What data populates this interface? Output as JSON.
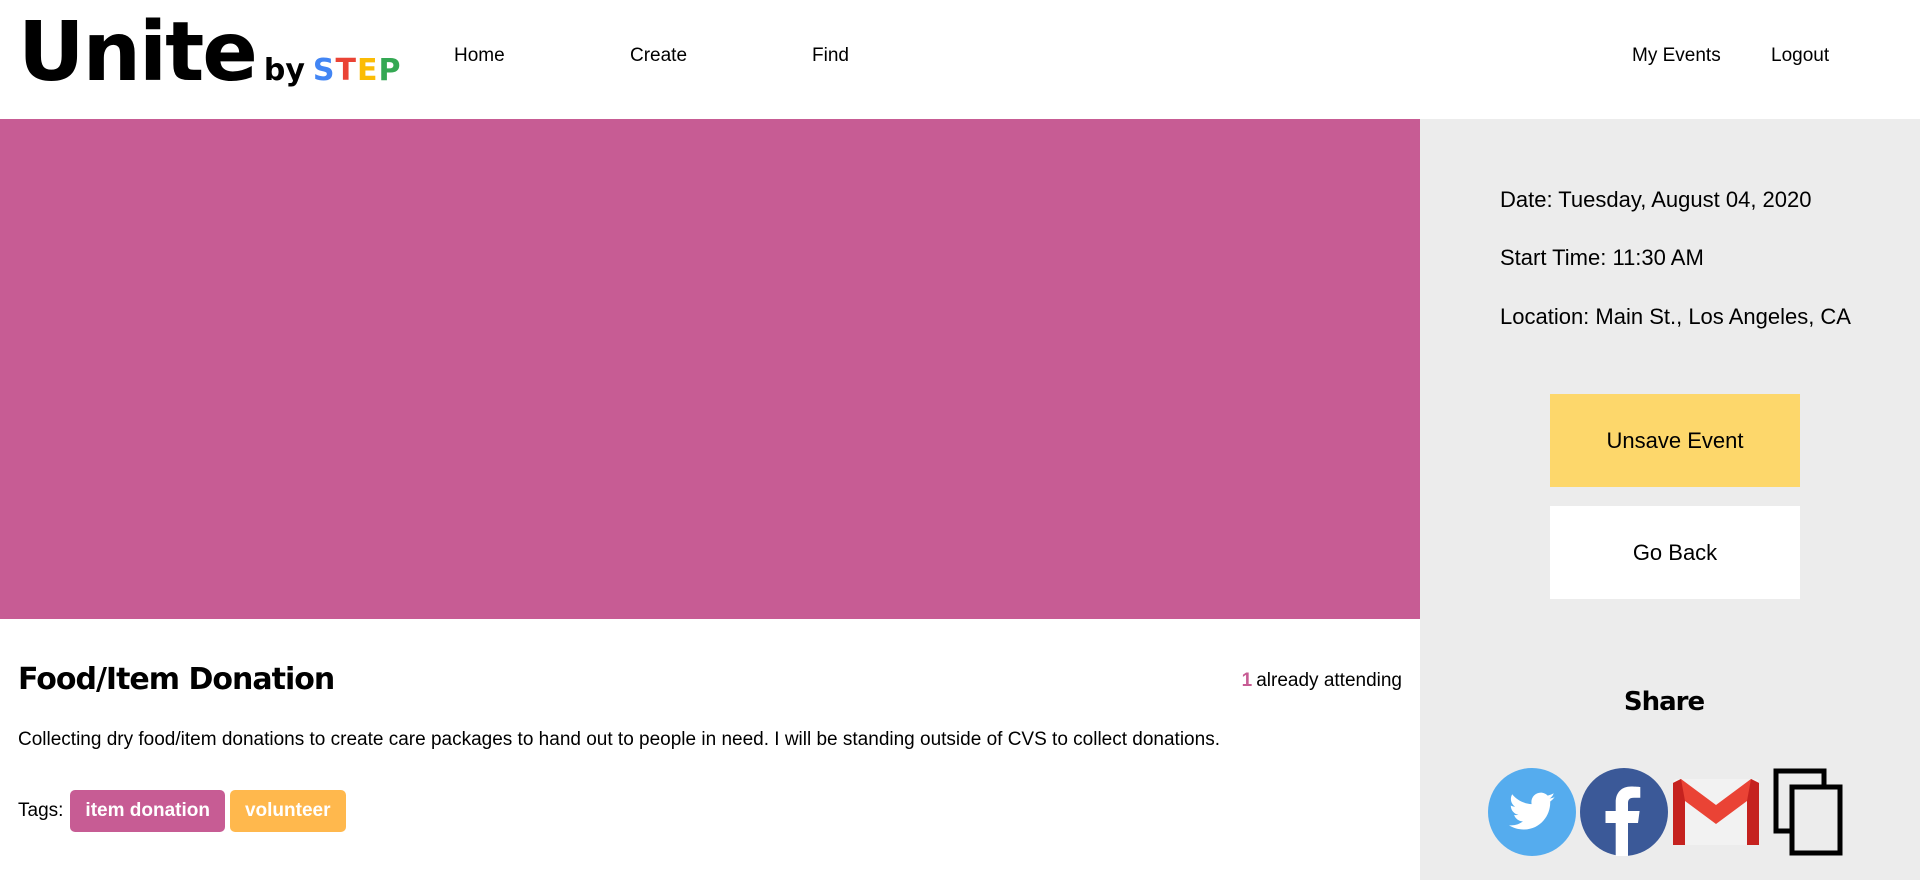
{
  "brand": {
    "name": "Unite",
    "by": "by",
    "step_letters": [
      "S",
      "T",
      "E",
      "P"
    ],
    "step_colors": [
      "#4285f4",
      "#ea4335",
      "#fbbc05",
      "#34a853"
    ]
  },
  "nav": {
    "home": "Home",
    "create": "Create",
    "find": "Find",
    "my_events": "My Events",
    "logout": "Logout"
  },
  "hero": {
    "color": "#c75c94"
  },
  "event": {
    "title": "Food/Item Donation",
    "attending_count": "1",
    "attending_text": "already attending",
    "description": "Collecting dry food/item donations to create care packages to hand out to people in need. I will be standing outside of CVS to collect donations.",
    "tags_label": "Tags:",
    "tags": [
      {
        "label": "item donation",
        "color": "#c75c94"
      },
      {
        "label": "volunteer",
        "color": "#ffb84d"
      }
    ]
  },
  "sidebar": {
    "date": "Date: Tuesday, August 04, 2020",
    "start_time": "Start Time: 11:30 AM",
    "location": "Location: Main St., Los Angeles, CA",
    "unsave_button": "Unsave Event",
    "go_back_button": "Go Back",
    "share_title": "Share",
    "share_icons": [
      "twitter-icon",
      "facebook-icon",
      "gmail-icon",
      "copy-icon"
    ]
  },
  "colors": {
    "accent_pink": "#c75c94",
    "button_yellow": "#fdd76b",
    "sidebar_bg": "#ececec",
    "twitter": "#55acee",
    "facebook": "#3b5998",
    "gmail_red": "#ea4335"
  }
}
